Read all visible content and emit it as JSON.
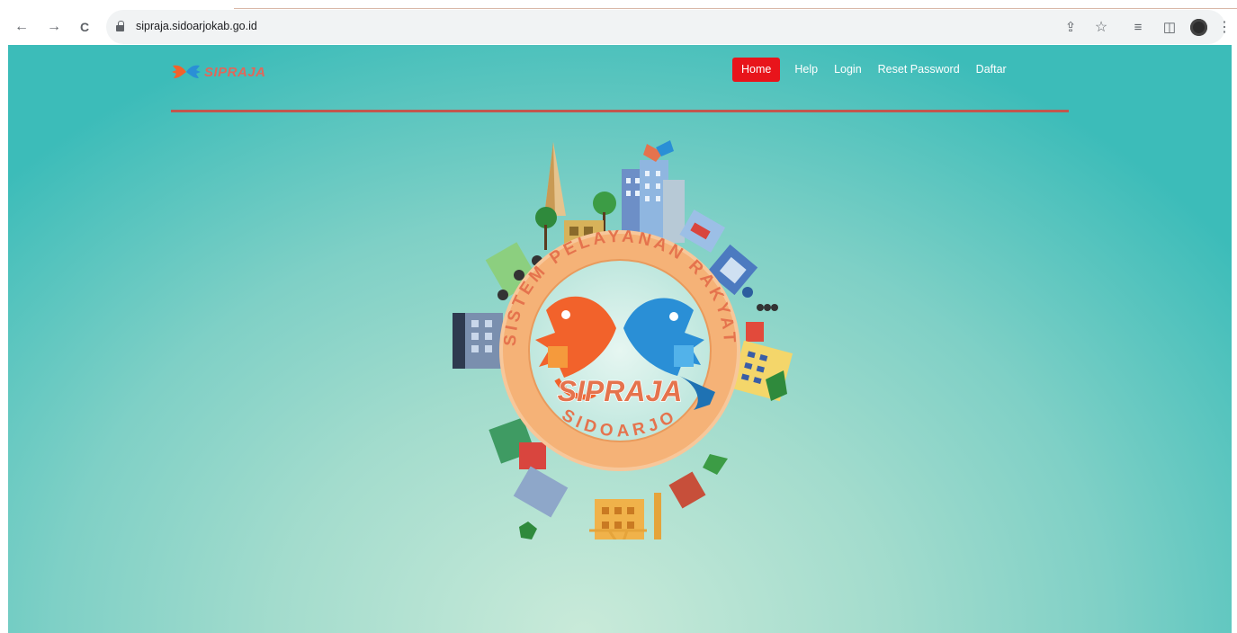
{
  "browser": {
    "url": "sipraja.sidoarjokab.go.id",
    "icons": [
      "back-icon",
      "forward-icon",
      "reload-icon",
      "lock-icon",
      "share-icon",
      "bookmark-star-icon",
      "reading-list-icon",
      "side-panel-icon",
      "profile-avatar",
      "more-menu-icon"
    ],
    "back_glyph": "←",
    "forward_glyph": "→",
    "reload_glyph": "C",
    "share_glyph": "⇪",
    "star_glyph": "☆",
    "reading_glyph": "≡",
    "sidepanel_glyph": "◫",
    "menu_glyph": "⋮"
  },
  "site": {
    "logo_text": "SIPRAJA",
    "nav": {
      "home": "Home",
      "help": "Help",
      "login": "Login",
      "reset_password": "Reset Password",
      "daftar": "Daftar"
    }
  },
  "emblem": {
    "ring_text": "SISTEM PELAYANAN RAKYAT SIDOARJO",
    "center_text": "SIPRAJA",
    "colors": {
      "ring": "#f5b277",
      "orange": "#f2622b",
      "blue": "#2a8fd6",
      "text": "#e5734d"
    }
  },
  "colors": {
    "accent_red": "#e8141b",
    "divider": "#c2564e",
    "page_teal": "#3cbcb9",
    "page_center": "#c9ead9"
  }
}
